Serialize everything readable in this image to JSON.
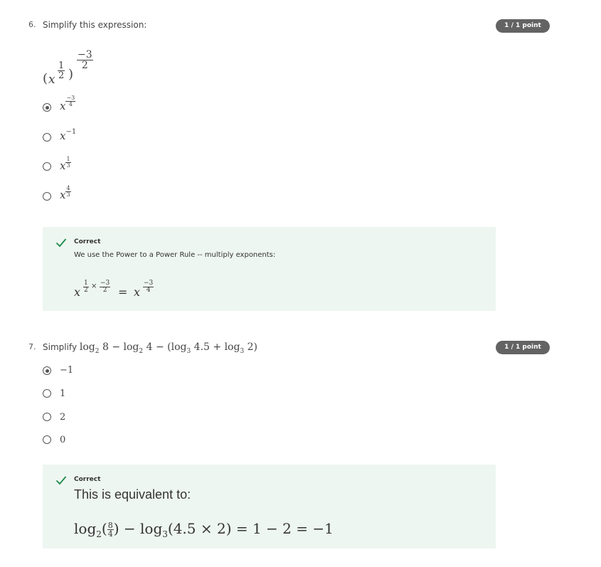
{
  "q6": {
    "number": "6.",
    "prompt": "Simplify this expression:",
    "points": "1 / 1 point",
    "expression": {
      "base": "x",
      "inner_num": "1",
      "inner_den": "2",
      "outer_num": "−3",
      "outer_den": "2"
    },
    "options": [
      {
        "base": "x",
        "exp_num": "−3",
        "exp_den": "4",
        "selected": true
      },
      {
        "base": "x",
        "exp": "−1",
        "selected": false
      },
      {
        "base": "x",
        "exp_num": "1",
        "exp_den": "3",
        "selected": false
      },
      {
        "base": "x",
        "exp_num": "4",
        "exp_den": "3",
        "selected": false
      }
    ],
    "feedback": {
      "status": "Correct",
      "text": "We use the Power to a Power Rule -- multiply exponents:",
      "eq": {
        "base": "x",
        "a_num": "1",
        "a_den": "2",
        "times": "×",
        "b_num": "−3",
        "b_den": "2",
        "equals": "=",
        "r_num": "−3",
        "r_den": "4"
      }
    }
  },
  "q7": {
    "number": "7.",
    "prompt_word": "Simplify",
    "prompt_math": {
      "t1": "log",
      "s1": "2",
      "v1": "8",
      "minus1": "−",
      "t2": "log",
      "s2": "2",
      "v2": "4",
      "minus2": "−",
      "open": "(",
      "t3": "log",
      "s3": "3",
      "v3": "4.5",
      "plus": "+",
      "t4": "log",
      "s4": "3",
      "v4": "2",
      "close": ")"
    },
    "points": "1 / 1 point",
    "options": [
      {
        "label": "−1",
        "selected": true
      },
      {
        "label": "1",
        "selected": false
      },
      {
        "label": "2",
        "selected": false
      },
      {
        "label": "0",
        "selected": false
      }
    ],
    "feedback": {
      "status": "Correct",
      "text": "This is equivalent to:",
      "eq": {
        "log1": "log",
        "s1": "2",
        "f_num": "8",
        "f_den": "4",
        "minus": "−",
        "log2": "log",
        "s2": "3",
        "arg2": "(4.5 × 2)",
        "rest": "= 1 − 2 = −1"
      }
    }
  },
  "colors": {
    "badge": "#636363",
    "feedback_bg": "#eef6f1",
    "check": "#1e8a4c"
  }
}
